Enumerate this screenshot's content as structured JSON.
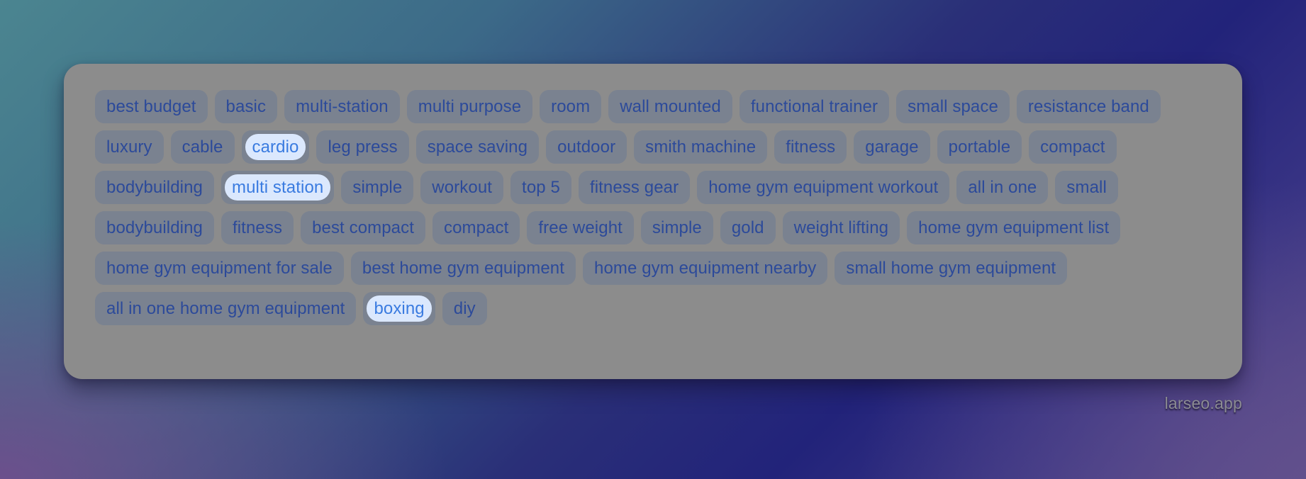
{
  "colors": {
    "card_background": "#8c8c8c",
    "tag_background": "#7a8290",
    "tag_text": "#2c4a9a",
    "selected_tag_background": "#dbe8fd",
    "selected_tag_text": "#3a7be0"
  },
  "tags": [
    {
      "label": "best budget",
      "selected": false
    },
    {
      "label": "basic",
      "selected": false
    },
    {
      "label": "multi-station",
      "selected": false
    },
    {
      "label": "multi purpose",
      "selected": false
    },
    {
      "label": "room",
      "selected": false
    },
    {
      "label": "wall mounted",
      "selected": false
    },
    {
      "label": "functional trainer",
      "selected": false
    },
    {
      "label": "small space",
      "selected": false
    },
    {
      "label": "resistance band",
      "selected": false
    },
    {
      "label": "luxury",
      "selected": false
    },
    {
      "label": "cable",
      "selected": false
    },
    {
      "label": "cardio",
      "selected": true
    },
    {
      "label": "leg press",
      "selected": false
    },
    {
      "label": "space saving",
      "selected": false
    },
    {
      "label": "outdoor",
      "selected": false
    },
    {
      "label": "smith machine",
      "selected": false
    },
    {
      "label": "fitness",
      "selected": false
    },
    {
      "label": "garage",
      "selected": false
    },
    {
      "label": "portable",
      "selected": false
    },
    {
      "label": "compact",
      "selected": false
    },
    {
      "label": "bodybuilding",
      "selected": false
    },
    {
      "label": "multi station",
      "selected": true
    },
    {
      "label": "simple",
      "selected": false
    },
    {
      "label": "workout",
      "selected": false
    },
    {
      "label": "top 5",
      "selected": false
    },
    {
      "label": "fitness gear",
      "selected": false
    },
    {
      "label": "home gym equipment workout",
      "selected": false
    },
    {
      "label": "all in one",
      "selected": false
    },
    {
      "label": "small",
      "selected": false
    },
    {
      "label": "bodybuilding",
      "selected": false
    },
    {
      "label": "fitness",
      "selected": false
    },
    {
      "label": "best compact",
      "selected": false
    },
    {
      "label": "compact",
      "selected": false
    },
    {
      "label": "free weight",
      "selected": false
    },
    {
      "label": "simple",
      "selected": false
    },
    {
      "label": "gold",
      "selected": false
    },
    {
      "label": "weight lifting",
      "selected": false
    },
    {
      "label": "home gym equipment list",
      "selected": false
    },
    {
      "label": "home gym equipment for sale",
      "selected": false
    },
    {
      "label": "best home gym equipment",
      "selected": false
    },
    {
      "label": "home gym equipment nearby",
      "selected": false
    },
    {
      "label": "small home gym equipment",
      "selected": false
    },
    {
      "label": "all in one home gym equipment",
      "selected": false
    },
    {
      "label": "boxing",
      "selected": true
    },
    {
      "label": "diy",
      "selected": false
    }
  ],
  "footer": {
    "brand": "larseo.app"
  }
}
